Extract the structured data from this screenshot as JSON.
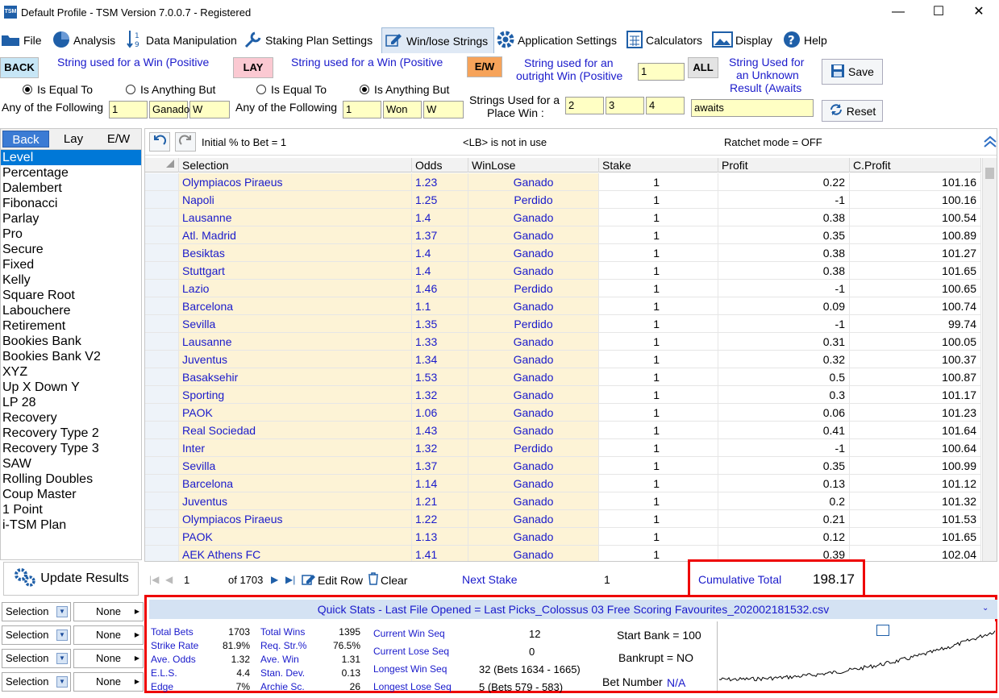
{
  "window": {
    "title": "Default Profile  - TSM Version 7.0.0.7 - Registered",
    "logo": "TSM"
  },
  "menu": [
    {
      "label": "File",
      "icon": "folder-icon"
    },
    {
      "label": "Analysis",
      "icon": "pie-chart-icon"
    },
    {
      "label": "Data Manipulation",
      "icon": "sort-icon"
    },
    {
      "label": "Staking Plan Settings",
      "icon": "wrench-icon"
    },
    {
      "label": "Win/lose Strings",
      "icon": "edit-icon"
    },
    {
      "label": "Application Settings",
      "icon": "gear-icon"
    },
    {
      "label": "Calculators",
      "icon": "calculator-icon"
    },
    {
      "label": "Display",
      "icon": "image-icon"
    },
    {
      "label": "Help",
      "icon": "help-icon"
    }
  ],
  "back": {
    "tag": "BACK",
    "desc": "String used for a Win (Positive",
    "equal": "Is Equal To",
    "anything": "Is Anything But",
    "any_label": "Any of the Following",
    "values": [
      "1",
      "Ganado",
      "W"
    ]
  },
  "lay": {
    "tag": "LAY",
    "desc": "String used for a Win (Positive",
    "equal": "Is Equal To",
    "anything": "Is Anything But",
    "any_label": "Any of the Following",
    "values": [
      "1",
      "Won",
      "W"
    ]
  },
  "ew": {
    "tag": "E/W",
    "desc1": "String used for an",
    "desc2": "outright Win (Positive",
    "win_value": "1",
    "place1": "Strings Used for a",
    "place2": "Place Win :",
    "place_values": [
      "2",
      "3",
      "4"
    ]
  },
  "all": {
    "tag": "ALL",
    "desc1": "String Used for",
    "desc2": "an Unknown",
    "desc3": "Result  (Awaits",
    "value": "awaits"
  },
  "buttons": {
    "save": "Save",
    "reset": "Reset"
  },
  "left_tabs": [
    "Back",
    "Lay",
    "E/W"
  ],
  "plans": [
    "Level",
    "Percentage",
    "Dalembert",
    "Fibonacci",
    "Parlay",
    "Pro",
    "Secure",
    "Fixed",
    "Kelly",
    "Square Root",
    "Labouchere",
    "Retirement",
    "Bookies Bank",
    "Bookies Bank V2",
    "XYZ",
    "Up X Down Y",
    "LP 28",
    "Recovery",
    "Recovery Type 2",
    "Recovery Type 3",
    "SAW",
    "Rolling Doubles",
    "Coup Master",
    "1 Point",
    "i-TSM Plan"
  ],
  "update_results": "Update Results",
  "grid_tool": {
    "initial": "Initial % to Bet = 1",
    "lb": "<LB> is not in use",
    "ratchet": "Ratchet mode = OFF"
  },
  "columns": [
    "Selection",
    "Odds",
    "WinLose",
    "Stake",
    "Profit",
    "C.Profit"
  ],
  "rows": [
    [
      "Olympiacos Piraeus",
      "1.23",
      "Ganado",
      "1",
      "0.22",
      "101.16"
    ],
    [
      "Napoli",
      "1.25",
      "Perdido",
      "1",
      "-1",
      "100.16"
    ],
    [
      "Lausanne",
      "1.4",
      "Ganado",
      "1",
      "0.38",
      "100.54"
    ],
    [
      "Atl. Madrid",
      "1.37",
      "Ganado",
      "1",
      "0.35",
      "100.89"
    ],
    [
      "Besiktas",
      "1.4",
      "Ganado",
      "1",
      "0.38",
      "101.27"
    ],
    [
      "Stuttgart",
      "1.4",
      "Ganado",
      "1",
      "0.38",
      "101.65"
    ],
    [
      "Lazio",
      "1.46",
      "Perdido",
      "1",
      "-1",
      "100.65"
    ],
    [
      "Barcelona",
      "1.1",
      "Ganado",
      "1",
      "0.09",
      "100.74"
    ],
    [
      "Sevilla",
      "1.35",
      "Perdido",
      "1",
      "-1",
      "99.74"
    ],
    [
      "Lausanne",
      "1.33",
      "Ganado",
      "1",
      "0.31",
      "100.05"
    ],
    [
      "Juventus",
      "1.34",
      "Ganado",
      "1",
      "0.32",
      "100.37"
    ],
    [
      "Basaksehir",
      "1.53",
      "Ganado",
      "1",
      "0.5",
      "100.87"
    ],
    [
      "Sporting",
      "1.32",
      "Ganado",
      "1",
      "0.3",
      "101.17"
    ],
    [
      "PAOK",
      "1.06",
      "Ganado",
      "1",
      "0.06",
      "101.23"
    ],
    [
      "Real Sociedad",
      "1.43",
      "Ganado",
      "1",
      "0.41",
      "101.64"
    ],
    [
      "Inter",
      "1.32",
      "Perdido",
      "1",
      "-1",
      "100.64"
    ],
    [
      "Sevilla",
      "1.37",
      "Ganado",
      "1",
      "0.35",
      "100.99"
    ],
    [
      "Barcelona",
      "1.14",
      "Ganado",
      "1",
      "0.13",
      "101.12"
    ],
    [
      "Juventus",
      "1.21",
      "Ganado",
      "1",
      "0.2",
      "101.32"
    ],
    [
      "Olympiacos Piraeus",
      "1.22",
      "Ganado",
      "1",
      "0.21",
      "101.53"
    ],
    [
      "PAOK",
      "1.13",
      "Ganado",
      "1",
      "0.12",
      "101.65"
    ],
    [
      "AEK Athens FC",
      "1.41",
      "Ganado",
      "1",
      "0.39",
      "102.04"
    ]
  ],
  "nav": {
    "page": "1",
    "of": "of 1703",
    "edit_row": "Edit Row",
    "clear": "Clear",
    "next_stake_label": "Next Stake",
    "next_stake_value": "1",
    "cum_label": "Cumulative Total",
    "cum_value": "198.17"
  },
  "filters": [
    {
      "field": "Selection",
      "value": "None"
    },
    {
      "field": "Selection",
      "value": "None"
    },
    {
      "field": "Selection",
      "value": "None"
    },
    {
      "field": "Selection",
      "value": "None"
    }
  ],
  "quick_stats": {
    "title": "Quick Stats - Last File Opened = Last Picks_Colossus 03 Free Scoring Favourites_202002181532.csv",
    "col1": [
      [
        "Total Bets",
        "1703"
      ],
      [
        "Strike Rate",
        "81.9%"
      ],
      [
        "Ave. Odds",
        "1.32"
      ],
      [
        "E.L.S.",
        "4.4"
      ],
      [
        "Edge",
        "7%"
      ]
    ],
    "col2": [
      [
        "Total Wins",
        "1395"
      ],
      [
        "Req. Str.%",
        "76.5%"
      ],
      [
        "Ave. Win",
        "1.31"
      ],
      [
        "Stan. Dev.",
        "0.13"
      ],
      [
        "Archie Sc.",
        "26"
      ]
    ],
    "col3": [
      [
        "Current Win Seq",
        "12"
      ],
      [
        "Current Lose Seq",
        "0"
      ],
      [
        "Longest Win Seq",
        "32  (Bets 1634 - 1665)"
      ],
      [
        "Longest Lose Seq",
        "5  (Bets 579 - 583)"
      ]
    ],
    "start_bank": "Start Bank = 100",
    "bankrupt": "Bankrupt = NO",
    "bet_number_label": "Bet Number",
    "bet_number_value": "N/A"
  }
}
